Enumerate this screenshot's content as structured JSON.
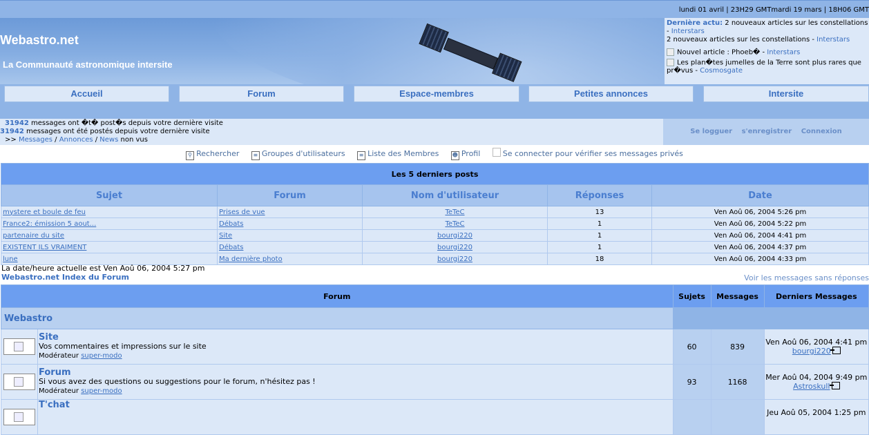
{
  "topbar": {
    "text": "lundi 01 avril | 23H29 GMTmardi 19 mars | 18H06 GMT"
  },
  "banner": {
    "title": "Webastro.net",
    "subtitle": "La Communauté astronomique intersite"
  },
  "news": {
    "label": "Dernière actu:",
    "line1": " 2 nouveaux articles sur les constellations - ",
    "link1": "Interstars",
    "line2": "2 nouveaux articles sur les constellations - ",
    "link2": "Interstars",
    "item1": "Nouvel article : Phoeb� - ",
    "item1_link": "Interstars",
    "item2": "Les plan�tes jumelles de la Terre sont plus rares que pr�vus - ",
    "item2_link": "Cosmosgate"
  },
  "nav": {
    "items": [
      {
        "label": "Accueil"
      },
      {
        "label": "Forum"
      },
      {
        "label": "Espace-membres"
      },
      {
        "label": "Petites annonces"
      },
      {
        "label": "Intersite"
      }
    ]
  },
  "info": {
    "count1": "31942",
    "text1": " messages ont �t� post�s depuis votre dernière visite",
    "count2": "31942",
    "text2": " messages ont été postés depuis votre dernière visite",
    "prefix": ">> ",
    "link_messages": "Messages",
    "sep1": " / ",
    "link_annonces": "Annonces",
    "sep2": " / ",
    "link_news": "News",
    "suffix": " non vus"
  },
  "login": {
    "login": "Se logguer",
    "register": "s'enregistrer",
    "connect": "Connexion"
  },
  "tools": {
    "search": "Rechercher",
    "groups": "Groupes d'utilisateurs",
    "members": "Liste des Membres",
    "profile": "Profil",
    "private": "Se connecter pour vérifier ses messages privés"
  },
  "posts": {
    "caption": "Les 5 derniers posts",
    "headers": {
      "subject": "Sujet",
      "forum": "Forum",
      "user": "Nom d'utilisateur",
      "replies": "Réponses",
      "date": "Date"
    },
    "rows": [
      {
        "subject": "mystere et boule de feu",
        "forum": "Prises de vue",
        "user": "TeTeC",
        "replies": "13",
        "date": "Ven Aoû 06, 2004 5:26 pm"
      },
      {
        "subject": "France2: émission 5 aout...",
        "forum": "Débats",
        "user": "TeTeC",
        "replies": "1",
        "date": "Ven Aoû 06, 2004 5:22 pm"
      },
      {
        "subject": "partenaire du site",
        "forum": "Site",
        "user": "bourgi220",
        "replies": "1",
        "date": "Ven Aoû 06, 2004 4:41 pm"
      },
      {
        "subject": "EXISTENT ILS VRAIMENT",
        "forum": "Débats",
        "user": "bourgi220",
        "replies": "1",
        "date": "Ven Aoû 06, 2004 4:37 pm"
      },
      {
        "subject": "lune",
        "forum": "Ma dernière photo",
        "user": "bourgi220",
        "replies": "18",
        "date": "Ven Aoû 06, 2004 4:33 pm"
      }
    ]
  },
  "status": {
    "current_time": "La date/heure actuelle est Ven Aoû 06, 2004 5:27 pm",
    "index_link": "Webastro.net Index du Forum",
    "unanswered": "Voir les messages sans réponses"
  },
  "forum": {
    "headers": {
      "forum": "Forum",
      "topics": "Sujets",
      "messages": "Messages",
      "last": "Derniers Messages"
    },
    "category": "Webastro",
    "rows": [
      {
        "name": "Site",
        "desc": "Vos commentaires et impressions sur le site",
        "mod_label": "Modérateur ",
        "mod": "super-modo",
        "topics": "60",
        "messages": "839",
        "last_date": "Ven Aoû 06, 2004 4:41 pm",
        "last_user": "bourgi220"
      },
      {
        "name": "Forum",
        "desc": "Si vous avez des questions ou suggestions pour le forum, n'hésitez pas !",
        "mod_label": "Modérateur ",
        "mod": "super-modo",
        "topics": "93",
        "messages": "1168",
        "last_date": "Mer Aoû 04, 2004 9:49 pm",
        "last_user": "Astroskull"
      },
      {
        "name": "T'chat",
        "desc": "",
        "mod_label": "",
        "mod": "",
        "topics": "",
        "messages": "",
        "last_date": "Jeu Aoû 05, 2004 1:25 pm",
        "last_user": ""
      }
    ]
  }
}
